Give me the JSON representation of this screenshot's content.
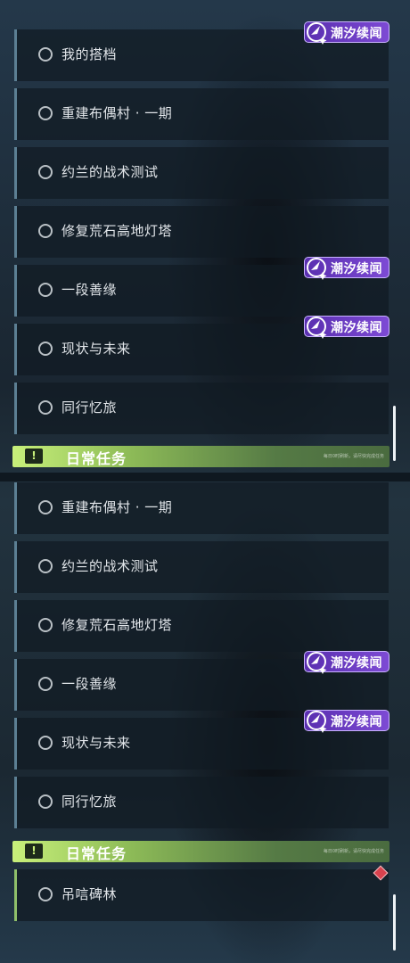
{
  "top_panel": {
    "quests": [
      {
        "title": "我的搭档"
      },
      {
        "title": "重建布偶村 · 一期"
      },
      {
        "title": "约兰的战术测试"
      },
      {
        "title": "修复荒石高地灯塔"
      },
      {
        "title": "一段善缘"
      },
      {
        "title": "现状与未来"
      },
      {
        "title": "同行忆旅"
      }
    ],
    "tags": [
      "潮汐续闻",
      "潮汐续闻",
      "潮汐续闻"
    ],
    "section": {
      "title": "日常任务",
      "icon": "alert-icon",
      "subtitle": "每日0时刷新，请尽快完成任务"
    }
  },
  "bottom_panel": {
    "quests": [
      {
        "title": "重建布偶村 · 一期"
      },
      {
        "title": "约兰的战术测试"
      },
      {
        "title": "修复荒石高地灯塔"
      },
      {
        "title": "一段善缘"
      },
      {
        "title": "现状与未来"
      },
      {
        "title": "同行忆旅"
      }
    ],
    "tags": [
      "潮汐续闻",
      "潮汐续闻"
    ],
    "section": {
      "title": "日常任务",
      "icon": "alert-icon",
      "subtitle": "每日0时刷新，请尽快完成任务"
    },
    "daily_quests": [
      {
        "title": "吊唁碑林"
      }
    ]
  },
  "colors": {
    "tag_purple": "#7d4ad4",
    "section_green": "#c8f07a",
    "quest_border": "#5c7f93",
    "alert_red": "#d9424e"
  }
}
